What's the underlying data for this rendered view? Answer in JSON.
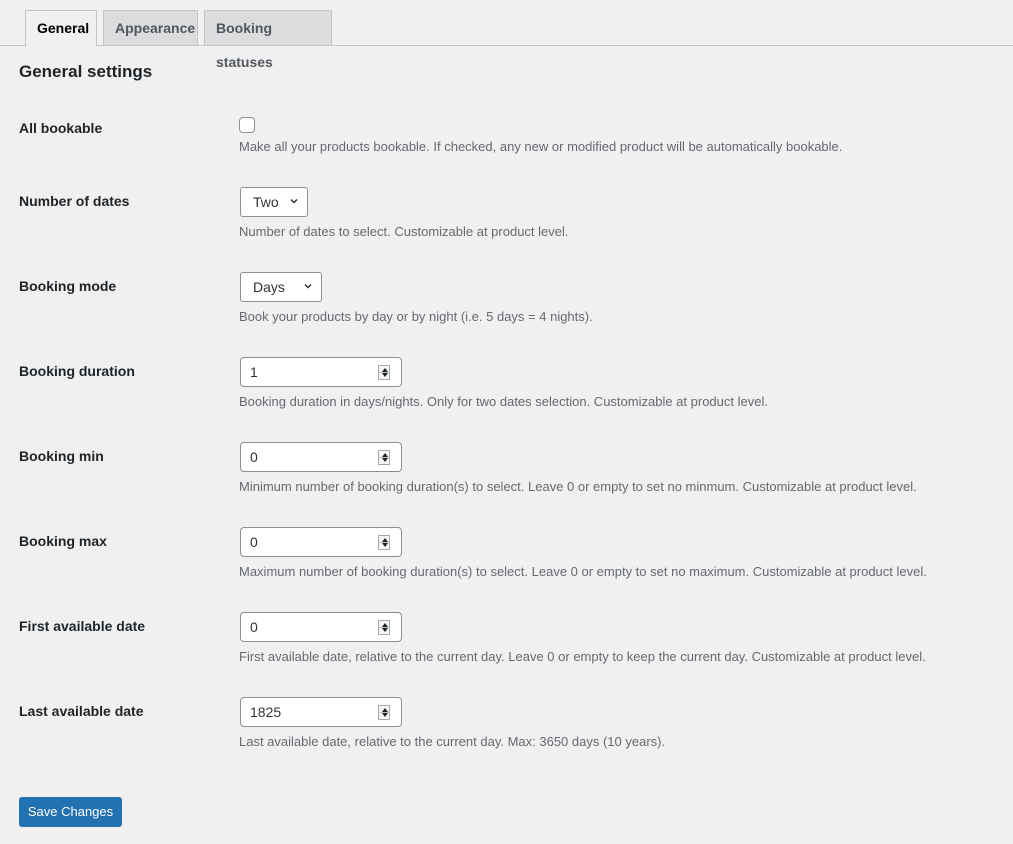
{
  "tabs": [
    {
      "label": "General",
      "active": true
    },
    {
      "label": "Appearance",
      "active": false
    },
    {
      "label": "Booking statuses",
      "active": false
    }
  ],
  "section_title": "General settings",
  "fields": {
    "all_bookable": {
      "label": "All bookable",
      "checked": false,
      "description": "Make all your products bookable. If checked, any new or modified product will be automatically bookable."
    },
    "number_of_dates": {
      "label": "Number of dates",
      "value": "Two",
      "description": "Number of dates to select. Customizable at product level."
    },
    "booking_mode": {
      "label": "Booking mode",
      "value": "Days",
      "description": "Book your products by day or by night (i.e. 5 days = 4 nights)."
    },
    "booking_duration": {
      "label": "Booking duration",
      "value": "1",
      "description": "Booking duration in days/nights. Only for two dates selection. Customizable at product level."
    },
    "booking_min": {
      "label": "Booking min",
      "value": "0",
      "description": "Minimum number of booking duration(s) to select. Leave 0 or empty to set no minmum. Customizable at product level."
    },
    "booking_max": {
      "label": "Booking max",
      "value": "0",
      "description": "Maximum number of booking duration(s) to select. Leave 0 or empty to set no maximum. Customizable at product level."
    },
    "first_available_date": {
      "label": "First available date",
      "value": "0",
      "description": "First available date, relative to the current day. Leave 0 or empty to keep the current day. Customizable at product level."
    },
    "last_available_date": {
      "label": "Last available date",
      "value": "1825",
      "description": "Last available date, relative to the current day. Max: 3650 days (10 years)."
    }
  },
  "save_button": {
    "label": "Save Changes",
    "color": "#2271b1"
  }
}
